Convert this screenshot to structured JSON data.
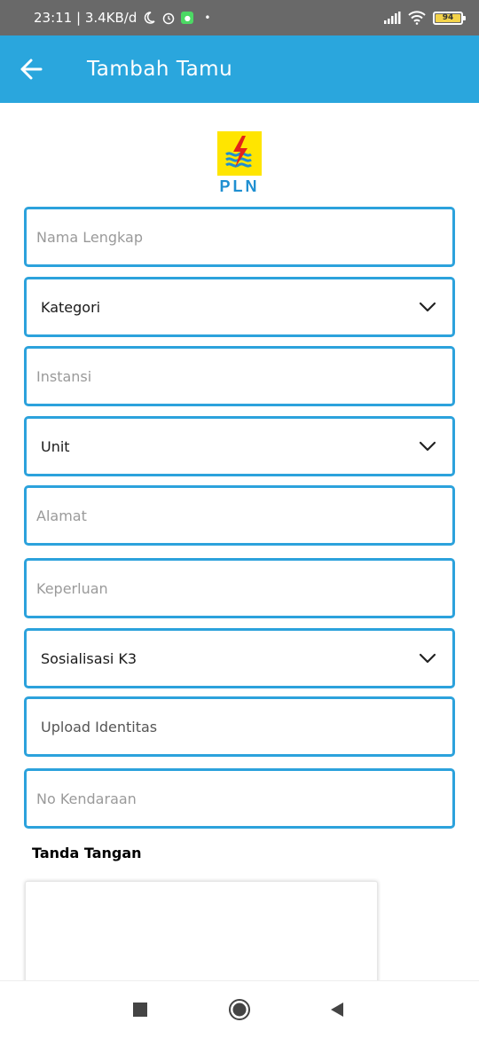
{
  "status_bar": {
    "time_speed": "23:11 | 3.4KB/d",
    "battery_level": "94"
  },
  "app_bar": {
    "title": "Tambah Tamu"
  },
  "logo": {
    "text": "PLN"
  },
  "form": {
    "nama_lengkap_placeholder": "Nama Lengkap",
    "kategori_label": "Kategori",
    "instansi_placeholder": "Instansi",
    "unit_label": "Unit",
    "alamat_placeholder": "Alamat",
    "keperluan_placeholder": "Keperluan",
    "sosialisasi_label": "Sosialisasi K3",
    "upload_label": "Upload Identitas",
    "no_kendaraan_placeholder": "No Kendaraan",
    "tanda_tangan_label": "Tanda Tangan"
  },
  "colors": {
    "accent": "#2aa6dd",
    "field_border": "#2ca2dc",
    "status_bar": "#696969",
    "logo_bg": "#ffe500",
    "logo_text": "#1f8fd1"
  }
}
